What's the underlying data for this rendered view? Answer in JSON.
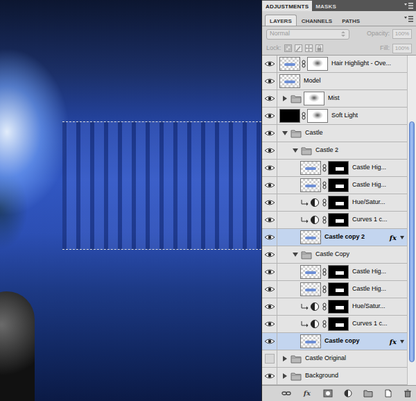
{
  "panel_tabs": [
    {
      "label": "ADJUSTMENTS",
      "selected": true
    },
    {
      "label": "MASKS",
      "selected": false
    }
  ],
  "layer_tabs": [
    {
      "label": "LAYERS",
      "selected": true
    },
    {
      "label": "CHANNELS",
      "selected": false
    },
    {
      "label": "PATHS",
      "selected": false
    }
  ],
  "blend_mode": {
    "value": "Normal",
    "disabled": true
  },
  "opacity": {
    "label": "Opacity:",
    "value": "100%",
    "disabled": true
  },
  "lock": {
    "label": "Lock:"
  },
  "fill": {
    "label": "Fill:",
    "value": "100%",
    "disabled": true
  },
  "fx_label": "fx",
  "layers": [
    {
      "name": "Hair Highlight - Ove...",
      "kind": "layer",
      "depth": 0,
      "visible": true,
      "selected": false,
      "expanded": false,
      "thumb": "checker",
      "mask": "light",
      "clipped": false,
      "effects": false
    },
    {
      "name": "Model",
      "kind": "layer",
      "depth": 0,
      "visible": true,
      "selected": false,
      "expanded": false,
      "thumb": "checker",
      "mask": "none",
      "clipped": false,
      "effects": false
    },
    {
      "name": "Mist",
      "kind": "folder",
      "depth": 0,
      "visible": true,
      "selected": false,
      "expanded": false,
      "thumb": "folder",
      "mask": "light",
      "clipped": false,
      "effects": false
    },
    {
      "name": "Soft Light",
      "kind": "layer",
      "depth": 0,
      "visible": true,
      "selected": false,
      "expanded": false,
      "thumb": "black",
      "mask": "light",
      "clipped": false,
      "effects": false
    },
    {
      "name": "Castle",
      "kind": "folder",
      "depth": 0,
      "visible": true,
      "selected": false,
      "expanded": true,
      "thumb": "folder",
      "mask": "none",
      "clipped": false,
      "effects": false
    },
    {
      "name": "Castle 2",
      "kind": "folder",
      "depth": 1,
      "visible": true,
      "selected": false,
      "expanded": true,
      "thumb": "folder",
      "mask": "none",
      "clipped": false,
      "effects": false
    },
    {
      "name": "Castle Hig...",
      "kind": "layer",
      "depth": 2,
      "visible": true,
      "selected": false,
      "expanded": false,
      "thumb": "checker",
      "mask": "dark",
      "clipped": false,
      "effects": false
    },
    {
      "name": "Castle Hig...",
      "kind": "layer",
      "depth": 2,
      "visible": true,
      "selected": false,
      "expanded": false,
      "thumb": "checker",
      "mask": "dark",
      "clipped": false,
      "effects": false
    },
    {
      "name": "Hue/Satur...",
      "kind": "adjustment",
      "depth": 2,
      "visible": true,
      "selected": false,
      "expanded": false,
      "thumb": "adjustment",
      "mask": "dark",
      "clipped": true,
      "effects": false
    },
    {
      "name": "Curves 1 c...",
      "kind": "adjustment",
      "depth": 2,
      "visible": true,
      "selected": false,
      "expanded": false,
      "thumb": "adjustment",
      "mask": "dark",
      "clipped": true,
      "effects": false
    },
    {
      "name": "Castle copy 2",
      "kind": "layer",
      "depth": 2,
      "visible": true,
      "selected": true,
      "expanded": false,
      "thumb": "checker",
      "mask": "none",
      "clipped": false,
      "effects": true
    },
    {
      "name": "Castle Copy",
      "kind": "folder",
      "depth": 1,
      "visible": true,
      "selected": false,
      "expanded": true,
      "thumb": "folder",
      "mask": "none",
      "clipped": false,
      "effects": false
    },
    {
      "name": "Castle Hig...",
      "kind": "layer",
      "depth": 2,
      "visible": true,
      "selected": false,
      "expanded": false,
      "thumb": "checker",
      "mask": "dark",
      "clipped": false,
      "effects": false
    },
    {
      "name": "Castle Hig...",
      "kind": "layer",
      "depth": 2,
      "visible": true,
      "selected": false,
      "expanded": false,
      "thumb": "checker",
      "mask": "dark",
      "clipped": false,
      "effects": false
    },
    {
      "name": "Hue/Satur...",
      "kind": "adjustment",
      "depth": 2,
      "visible": true,
      "selected": false,
      "expanded": false,
      "thumb": "adjustment",
      "mask": "dark",
      "clipped": true,
      "effects": false
    },
    {
      "name": "Curves 1 c...",
      "kind": "adjustment",
      "depth": 2,
      "visible": true,
      "selected": false,
      "expanded": false,
      "thumb": "adjustment",
      "mask": "dark",
      "clipped": true,
      "effects": false
    },
    {
      "name": "Castle copy",
      "kind": "layer",
      "depth": 2,
      "visible": true,
      "selected": true,
      "expanded": false,
      "thumb": "checker",
      "mask": "none",
      "clipped": false,
      "effects": true
    },
    {
      "name": "Castle Original",
      "kind": "folder",
      "depth": 0,
      "visible": false,
      "selected": false,
      "expanded": false,
      "thumb": "folder",
      "mask": "none",
      "clipped": false,
      "effects": false
    },
    {
      "name": "Background",
      "kind": "folder",
      "depth": 0,
      "visible": true,
      "selected": false,
      "expanded": false,
      "thumb": "folder",
      "mask": "none",
      "clipped": false,
      "effects": false
    }
  ],
  "scrollbar": {
    "offset": 0.2,
    "level": 0.73
  }
}
